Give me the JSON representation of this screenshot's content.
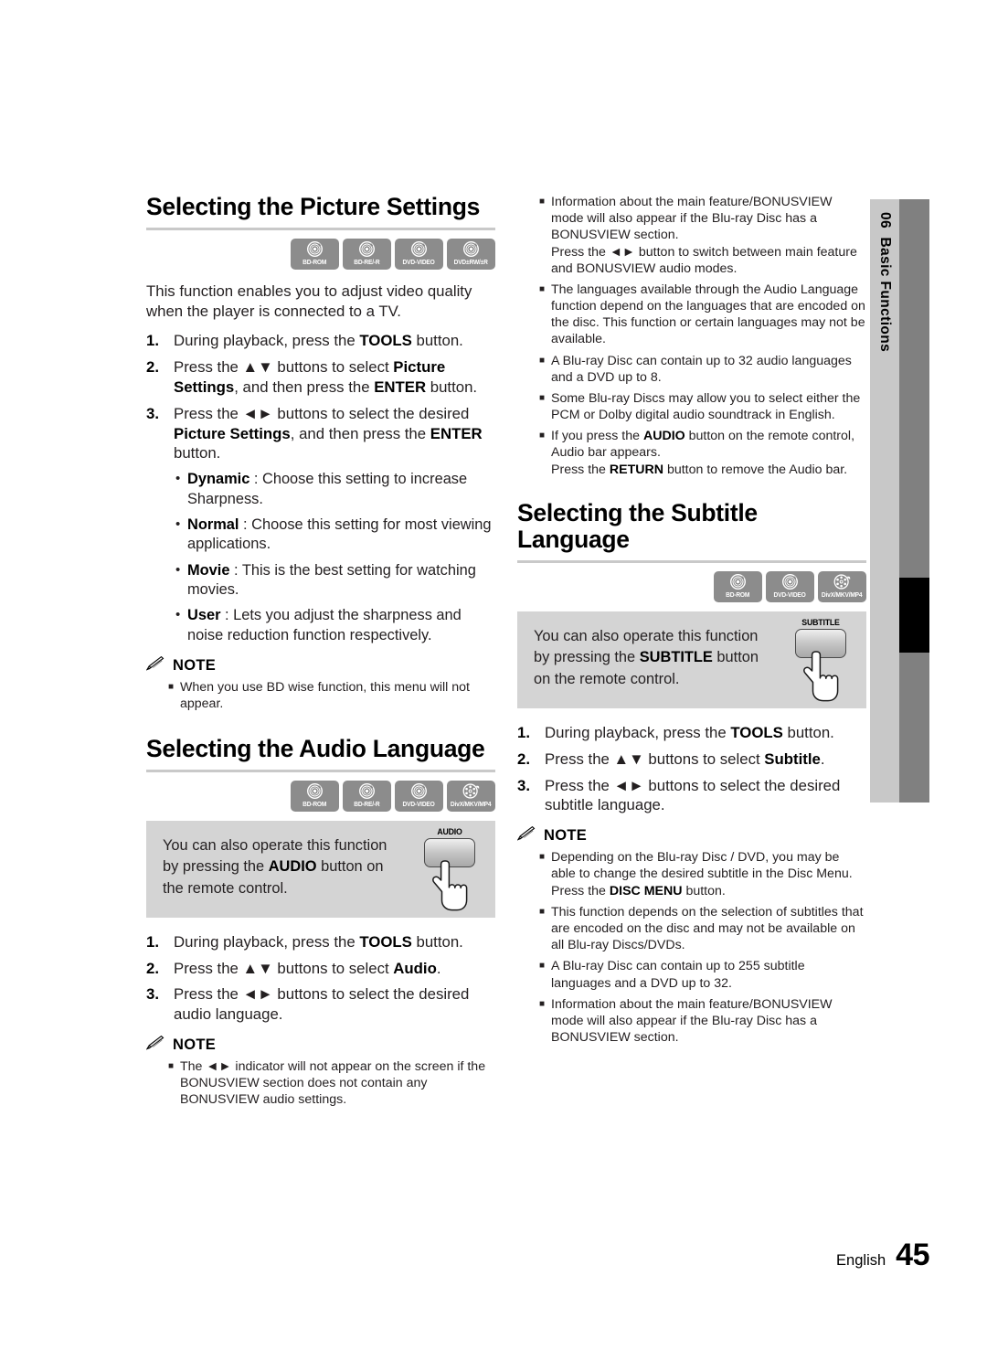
{
  "page": {
    "number": "45",
    "language_label": "English",
    "chapter_number": "06",
    "chapter_title": "Basic Functions"
  },
  "icons": {
    "note": "pencil-icon",
    "disc": "disc-icon",
    "hand": "pointing-hand-icon"
  },
  "sections": {
    "picture": {
      "title": "Selecting the Picture Settings",
      "discs": [
        "BD-ROM",
        "BD-RE/-R",
        "DVD-VIDEO",
        "DVD±RW/±R"
      ],
      "disc_kinds": [
        "disc",
        "disc",
        "disc",
        "disc"
      ],
      "intro": "This function enables you to adjust video quality when the player is connected to a TV.",
      "steps": [
        {
          "num": "1.",
          "html": "During playback, press the <b>TOOLS</b> button."
        },
        {
          "num": "2.",
          "html": "Press the ▲▼ buttons to select <b>Picture Settings</b>, and then press the <b>ENTER</b> button."
        },
        {
          "num": "3.",
          "html": "Press the ◄► buttons to select the desired <b>Picture Settings</b>, and then press the <b>ENTER</b> button."
        }
      ],
      "options": [
        {
          "html": "<b>Dynamic</b> : Choose this setting to increase Sharpness."
        },
        {
          "html": "<b>Normal</b> : Choose this setting for most viewing applications."
        },
        {
          "html": "<b>Movie</b> : This is the best setting for watching movies."
        },
        {
          "html": "<b>User</b> : Lets you adjust the sharpness and noise reduction function respectively."
        }
      ],
      "note_label": "NOTE",
      "notes": [
        {
          "html": "When you use BD wise function, this menu will not appear."
        }
      ]
    },
    "audio": {
      "title": "Selecting the Audio Language",
      "discs": [
        "BD-ROM",
        "BD-RE/-R",
        "DVD-VIDEO",
        "DivX/MKV/MP4"
      ],
      "disc_kinds": [
        "disc",
        "disc",
        "disc",
        "divx"
      ],
      "tip": {
        "html": "You can also operate this function by pressing the <b>AUDIO</b> button on the remote control.",
        "key_label": "AUDIO"
      },
      "steps": [
        {
          "num": "1.",
          "html": "During playback, press the <b>TOOLS</b> button."
        },
        {
          "num": "2.",
          "html": "Press the ▲▼ buttons to select <b>Audio</b>."
        },
        {
          "num": "3.",
          "html": "Press the ◄► buttons to select the desired audio language."
        }
      ],
      "note_label": "NOTE",
      "notes": [
        {
          "html": "The ◄► indicator will not appear on the screen if the BONUSVIEW section does not contain any BONUSVIEW audio settings."
        },
        {
          "html": "Information about the main feature/BONUSVIEW mode will also appear if the Blu-ray Disc has a BONUSVIEW section.<br>Press the ◄► button to switch between main feature and BONUSVIEW audio modes."
        },
        {
          "html": "The languages available through the Audio Language function depend on the languages that are encoded on the disc. This function or certain languages may not be available."
        },
        {
          "html": "A Blu-ray Disc can contain up to 32 audio languages and a DVD up to 8."
        },
        {
          "html": "Some Blu-ray Discs may allow you to select either the PCM or Dolby digital audio soundtrack in English."
        },
        {
          "html": "If you press the <b>AUDIO</b> button on the remote control, Audio bar appears.<br>Press the <b>RETURN</b> button to remove the Audio bar."
        }
      ]
    },
    "subtitle": {
      "title": "Selecting the Subtitle Language",
      "discs": [
        "BD-ROM",
        "DVD-VIDEO",
        "DivX/MKV/MP4"
      ],
      "disc_kinds": [
        "disc",
        "disc",
        "divx"
      ],
      "tip": {
        "html": "You can also operate this function by pressing the <b>SUBTITLE</b> button on the remote control.",
        "key_label": "SUBTITLE"
      },
      "steps": [
        {
          "num": "1.",
          "html": "During playback, press the <b>TOOLS</b> button."
        },
        {
          "num": "2.",
          "html": "Press the ▲▼ buttons to select <b>Subtitle</b>."
        },
        {
          "num": "3.",
          "html": "Press the ◄► buttons to select the desired subtitle language."
        }
      ],
      "note_label": "NOTE",
      "notes": [
        {
          "html": "Depending on the Blu-ray Disc / DVD, you may be able to change the desired subtitle in the Disc Menu. Press the <b>DISC MENU</b> button."
        },
        {
          "html": "This function depends on the selection of subtitles that are encoded on the disc and may not be available on all Blu-ray Discs/DVDs."
        },
        {
          "html": "A Blu-ray Disc can contain up to 255 subtitle languages and a DVD up to 32."
        },
        {
          "html": "Information about the main feature/BONUSVIEW mode will also appear if the Blu-ray Disc has a BONUSVIEW section."
        }
      ]
    }
  },
  "colors": {
    "rule": "#c9c9c9",
    "tip_bg": "#d4d4d4",
    "icon_bg": "#8c8c8c",
    "tab_light": "#c8c8c8",
    "tab_dark": "#808080",
    "tab_mark": "#000000"
  }
}
